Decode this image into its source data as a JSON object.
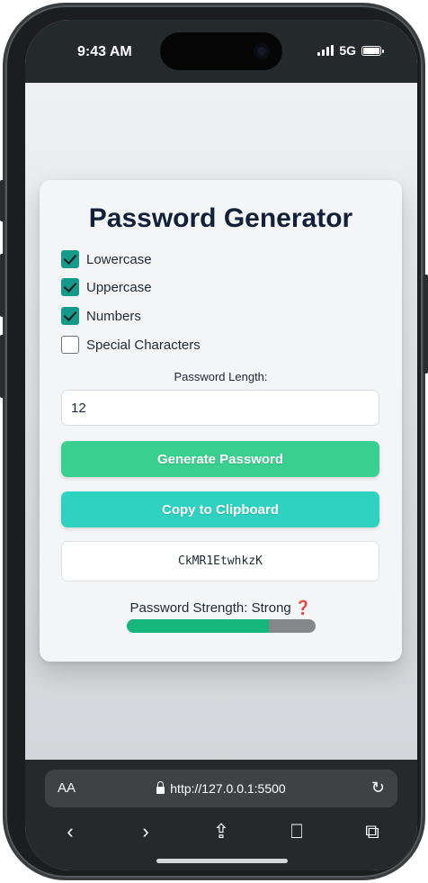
{
  "status": {
    "time": "9:43 AM",
    "network": "5G"
  },
  "app": {
    "title": "Password Generator",
    "options": [
      {
        "label": "Lowercase",
        "checked": true
      },
      {
        "label": "Uppercase",
        "checked": true
      },
      {
        "label": "Numbers",
        "checked": true
      },
      {
        "label": "Special Characters",
        "checked": false
      }
    ],
    "length_label": "Password Length:",
    "length_value": "12",
    "generate_label": "Generate Password",
    "copy_label": "Copy to Clipboard",
    "password": "CkMR1EtwhkzK",
    "strength_text": "Password Strength: Strong",
    "strength_icon": "❓",
    "strength_fraction": 0.75,
    "colors": {
      "accent_green": "#38cf8f",
      "accent_teal": "#2fd2c0",
      "checkbox": "#14998a",
      "strength_fill": "#16b77c"
    }
  },
  "browser": {
    "text_size_label": "AA",
    "url": "http://127.0.0.1:5500",
    "icons": [
      "back-icon",
      "forward-icon",
      "share-icon",
      "bookmarks-icon",
      "tabs-icon"
    ]
  }
}
